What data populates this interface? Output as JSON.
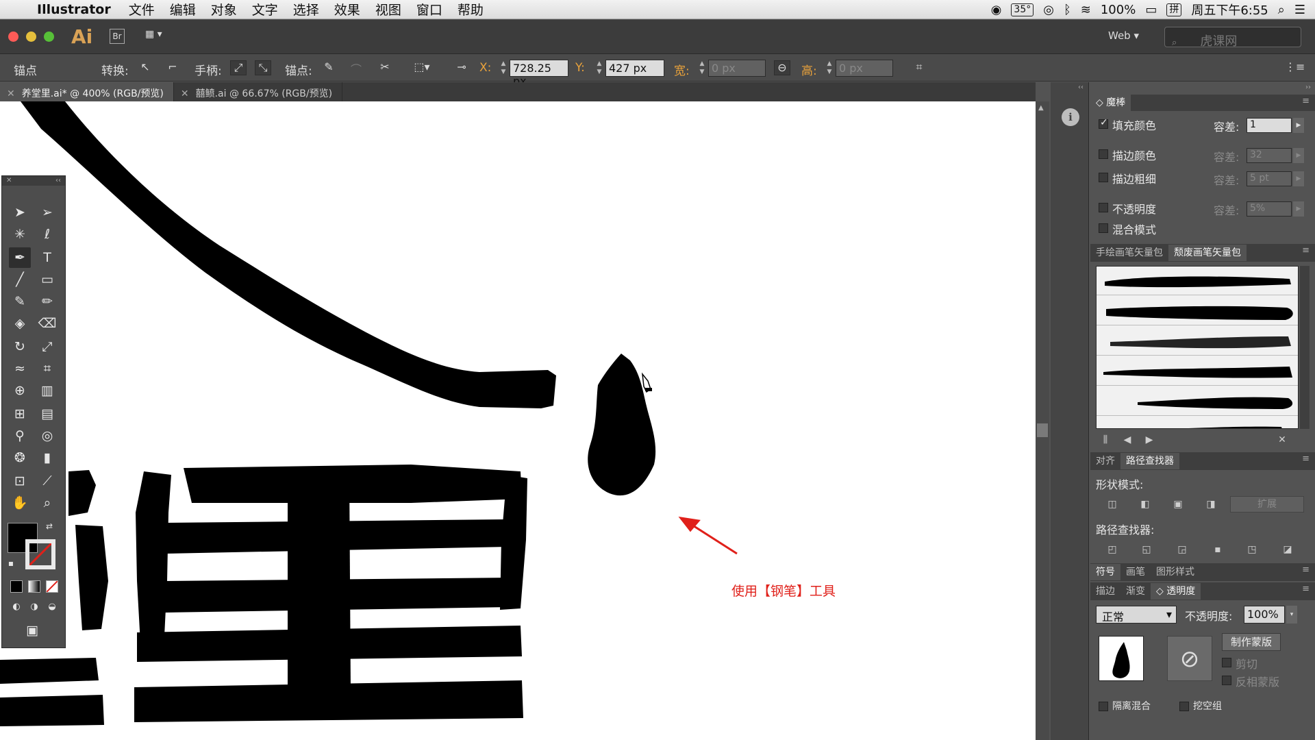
{
  "menubar": {
    "app_name": "Illustrator",
    "items": [
      "文件",
      "编辑",
      "对象",
      "文字",
      "选择",
      "效果",
      "视图",
      "窗口",
      "帮助"
    ],
    "status": {
      "temp": "35°",
      "battery": "100%",
      "ime": "拼",
      "clock": "周五下午6:55"
    }
  },
  "appbar": {
    "logo": "Ai",
    "bridge": "Br",
    "workspace": "Web",
    "watermark": "虎课网"
  },
  "control": {
    "anchor_label": "锚点",
    "convert_label": "转换:",
    "handle_label": "手柄:",
    "anchors_label": "锚点:",
    "x_label": "X:",
    "x_value": "728.25 px",
    "y_label": "Y:",
    "y_value": "427 px",
    "w_label": "宽:",
    "w_value": "0 px",
    "h_label": "高:",
    "h_value": "0 px"
  },
  "tabs": [
    {
      "label": "养堂里.ai* @ 400% (RGB/预览)",
      "active": true
    },
    {
      "label": "囍鲼.ai @ 66.67% (RGB/预览)",
      "active": false
    }
  ],
  "annotation": "使用【钢笔】工具",
  "panels": {
    "magic_wand": {
      "tab": "魔棒",
      "tolerance_label": "容差:",
      "rows": [
        {
          "label": "填充颜色",
          "checked": true,
          "tolerance": "1",
          "enabled": true
        },
        {
          "label": "描边颜色",
          "checked": false,
          "tolerance": "32",
          "enabled": false
        },
        {
          "label": "描边粗细",
          "checked": false,
          "tolerance": "5 pt",
          "enabled": false
        },
        {
          "label": "不透明度",
          "checked": false,
          "tolerance": "5%",
          "enabled": false
        },
        {
          "label": "混合模式",
          "checked": false,
          "tolerance": "",
          "enabled": false
        }
      ]
    },
    "brush_tabs": [
      "手绘画笔矢量包",
      "颓废画笔矢量包"
    ],
    "pathfinder": {
      "tabs": [
        "对齐",
        "路径查找器"
      ],
      "shape_modes_label": "形状模式:",
      "expand_label": "扩展",
      "pathfinders_label": "路径查找器:"
    },
    "symbol_tabs": [
      "符号",
      "画笔",
      "图形样式"
    ],
    "transparency": {
      "tabs": [
        "描边",
        "渐变",
        "透明度"
      ],
      "blend_mode": "正常",
      "opacity_label": "不透明度:",
      "opacity": "100%",
      "make_mask": "制作蒙版",
      "clip": "剪切",
      "invert": "反相蒙版",
      "isolate": "隔离混合",
      "knockout": "挖空组"
    }
  },
  "colors": {
    "accent": "#e9a23b",
    "annotation": "#e0201a",
    "ai_logo": "#d9a256"
  }
}
